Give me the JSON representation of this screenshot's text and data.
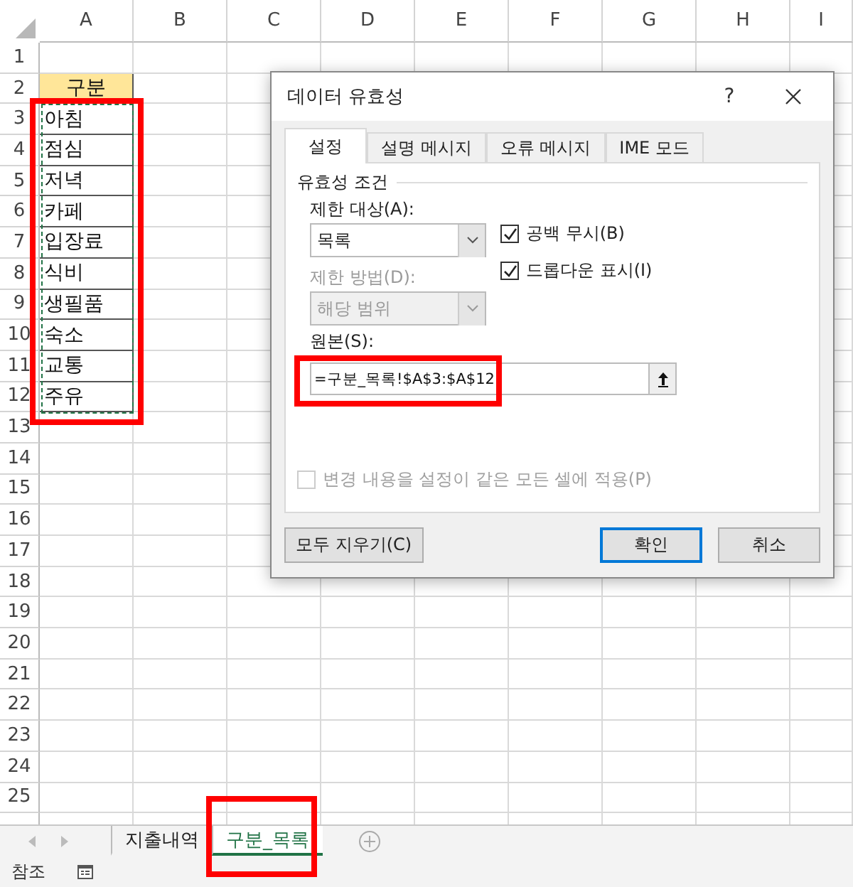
{
  "sheet": {
    "columns": [
      "A",
      "B",
      "C",
      "D",
      "E",
      "F",
      "G",
      "H",
      "I"
    ],
    "rows": [
      "1",
      "2",
      "3",
      "4",
      "5",
      "6",
      "7",
      "8",
      "9",
      "10",
      "11",
      "12",
      "13",
      "14",
      "15",
      "16",
      "17",
      "18",
      "19",
      "20",
      "21",
      "22",
      "23",
      "24",
      "25"
    ],
    "header_cell": "구분",
    "list_cells": [
      "아침",
      "점심",
      "저녁",
      "카페",
      "입장료",
      "식비",
      "생필품",
      "숙소",
      "교통",
      "주유"
    ]
  },
  "dialog": {
    "title": "데이터 유효성",
    "help": "?",
    "tabs": [
      {
        "label": "설정",
        "selected": true
      },
      {
        "label": "설명 메시지",
        "selected": false
      },
      {
        "label": "오류 메시지",
        "selected": false
      },
      {
        "label": "IME 모드",
        "selected": false
      }
    ],
    "group_title": "유효성 조건",
    "allow_label": "제한 대상(A):",
    "allow_value": "목록",
    "options": [
      {
        "label": "공백 무시(B)",
        "checked": true
      },
      {
        "label": "드롭다운 표시(I)",
        "checked": true
      }
    ],
    "data_label": "제한 방법(D):",
    "data_value": "해당 범위",
    "data_disabled": true,
    "source_label": "원본(S):",
    "source_value": "=구분_목록!$A$3:$A$12",
    "apply_all": {
      "label": "변경 내용을 설정이 같은 모든 셀에 적용(P)",
      "checked": false,
      "disabled": true
    },
    "clear_button": "모두 지우기(C)",
    "buttons": [
      {
        "label": "확인",
        "default": true
      },
      {
        "label": "취소",
        "default": false
      }
    ]
  },
  "sheet_tabs": [
    {
      "label": "지출내역",
      "selected": false
    },
    {
      "label": "구분_목록",
      "selected": true
    }
  ],
  "status_bar": {
    "mode": "참조"
  }
}
